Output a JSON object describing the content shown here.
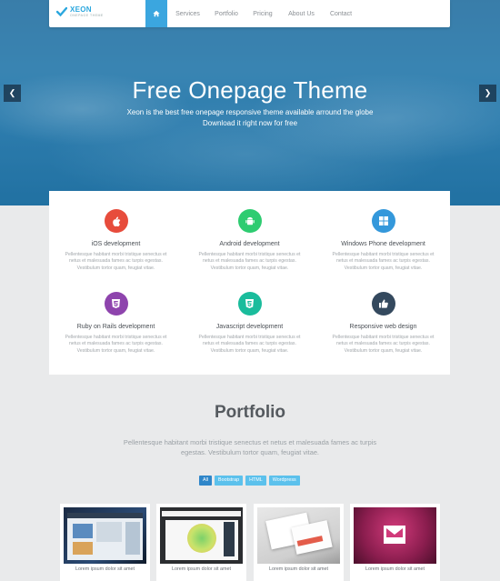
{
  "brand": {
    "name": "XEON",
    "tagline": "ONEPAGE THEME"
  },
  "nav": [
    {
      "label": ""
    },
    {
      "label": "Services"
    },
    {
      "label": "Portfolio"
    },
    {
      "label": "Pricing"
    },
    {
      "label": "About Us"
    },
    {
      "label": "Contact"
    }
  ],
  "hero": {
    "title": "Free Onepage Theme",
    "line1": "Xeon is the best free onepage responsive theme available arround the globe",
    "line2": "Download it right now for free"
  },
  "services": [
    {
      "title": "iOS development",
      "icon": "apple-icon",
      "color": "#e74c3c",
      "text": "Pellentesque habitant morbi tristique senectus et netus et malesuada fames ac turpis egestas. Vestibulum tortor quam, feugiat vitae."
    },
    {
      "title": "Android development",
      "icon": "android-icon",
      "color": "#2ecc71",
      "text": "Pellentesque habitant morbi tristique senectus et netus et malesuada fames ac turpis egestas. Vestibulum tortor quam, feugiat vitae."
    },
    {
      "title": "Windows Phone development",
      "icon": "windows-icon",
      "color": "#3498db",
      "text": "Pellentesque habitant morbi tristique senectus et netus et malesuada fames ac turpis egestas. Vestibulum tortor quam, feugiat vitae."
    },
    {
      "title": "Ruby on Rails development",
      "icon": "html5-icon",
      "color": "#8e44ad",
      "text": "Pellentesque habitant morbi tristique senectus et netus et malesuada fames ac turpis egestas. Vestibulum tortor quam, feugiat vitae."
    },
    {
      "title": "Javascript development",
      "icon": "css3-icon",
      "color": "#1abc9c",
      "text": "Pellentesque habitant morbi tristique senectus et netus et malesuada fames ac turpis egestas. Vestibulum tortor quam, feugiat vitae."
    },
    {
      "title": "Responsive web design",
      "icon": "thumbs-up-icon",
      "color": "#34495e",
      "text": "Pellentesque habitant morbi tristique senectus et netus et malesuada fames ac turpis egestas. Vestibulum tortor quam, feugiat vitae."
    }
  ],
  "portfolio": {
    "title": "Portfolio",
    "text": "Pellentesque habitant morbi tristique senectus et netus et malesuada fames ac turpis egestas. Vestibulum tortor quam, feugiat vitae.",
    "filters": [
      "All",
      "Bootstrap",
      "HTML",
      "Wordpress"
    ],
    "items": [
      {
        "caption": "Lorem ipsum dolor sit amet"
      },
      {
        "caption": "Lorem ipsum dolor sit amet"
      },
      {
        "caption": "Lorem ipsum dolor sit amet"
      },
      {
        "caption": "Lorem ipsum dolor sit amet"
      }
    ]
  },
  "colors": {
    "accent": "#3ba6df",
    "filter_active": "#2f86c9",
    "filter": "#5cc1ec"
  }
}
